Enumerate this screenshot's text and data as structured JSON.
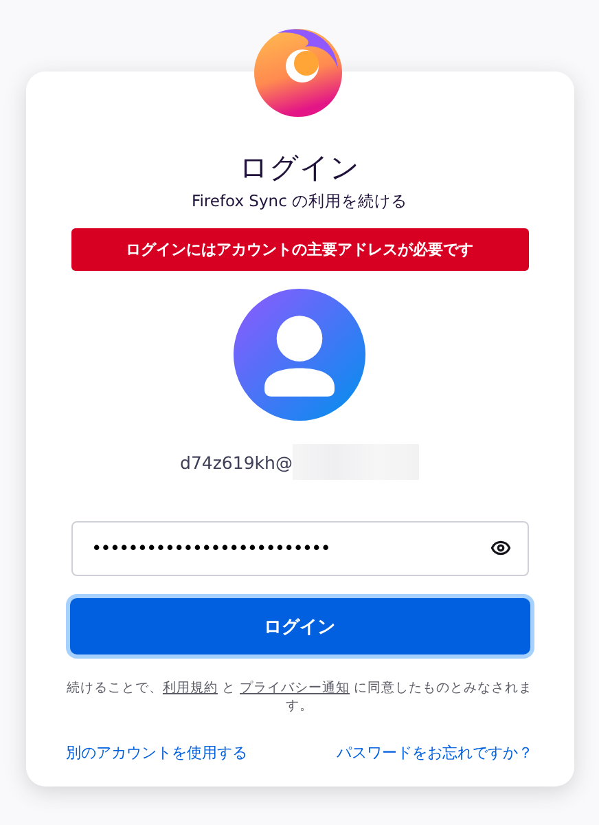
{
  "title": "ログイン",
  "subtitle": "Firefox Sync の利用を続ける",
  "error_banner": "ログインにはアカウントの主要アドレスが必要です",
  "email": "d74z619kh@",
  "password": {
    "value": "••••••••••••••••••••••••••"
  },
  "submit_button": "ログイン",
  "terms": {
    "before": "続けることで、",
    "terms_link": "利用規約",
    "middle": " と ",
    "privacy_link": "プライバシー通知",
    "after": " に同意したものとみなされます。"
  },
  "links": [
    {
      "label": "別のアカウントを使用する"
    },
    {
      "label": "パスワードをお忘れですか？"
    }
  ]
}
